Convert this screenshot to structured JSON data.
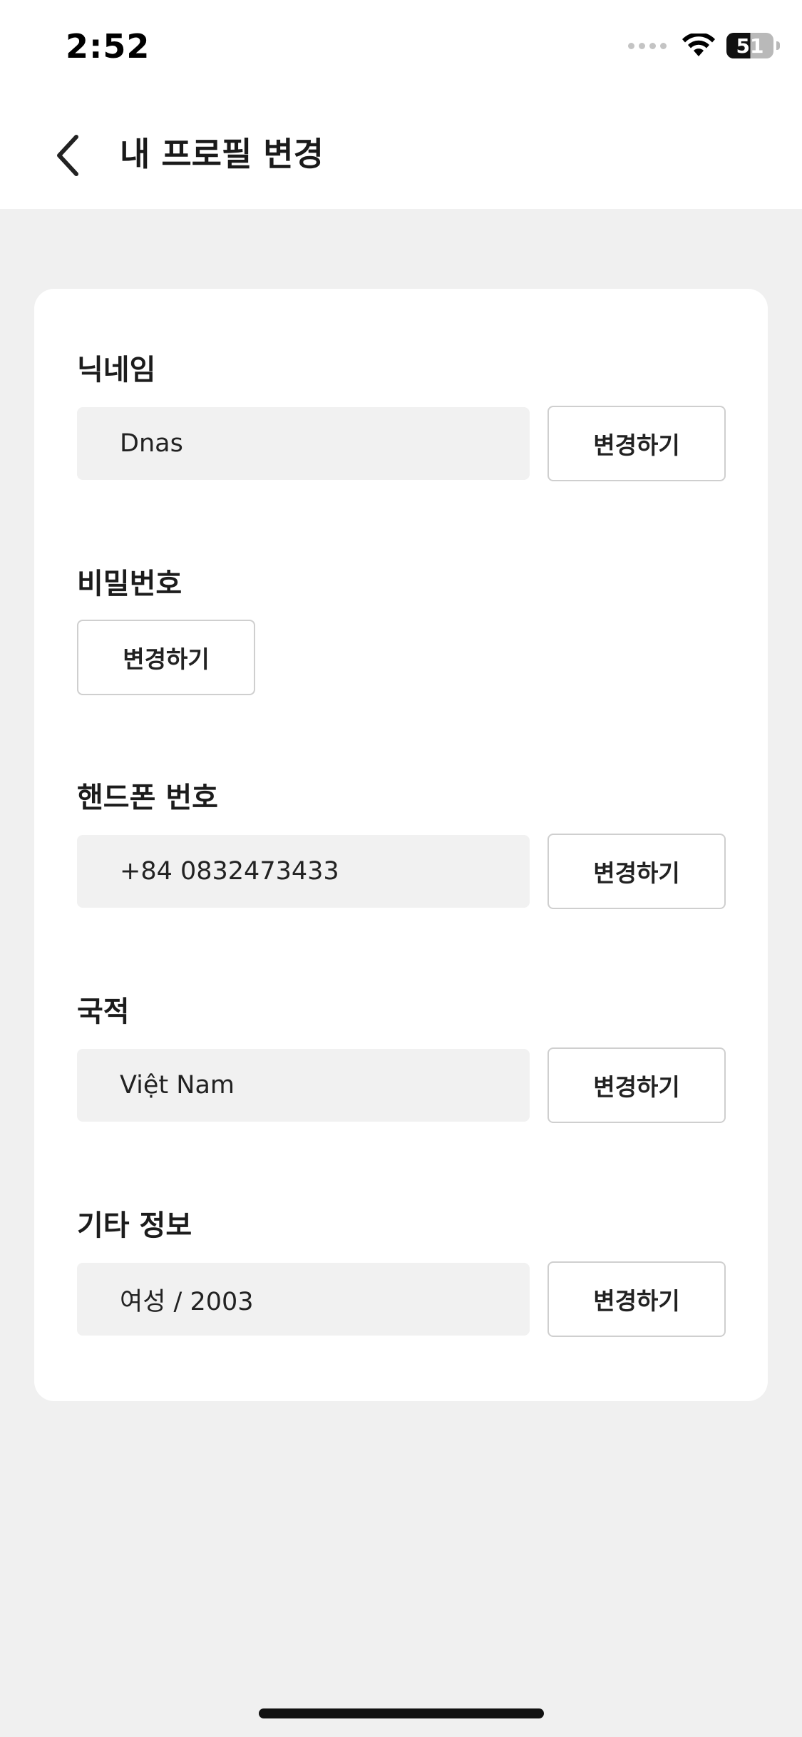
{
  "status_bar": {
    "time": "2:52",
    "battery_level": "51",
    "battery_fraction": 0.51
  },
  "header": {
    "back_icon": "chevron-left-icon",
    "title": "내 프로필 변경"
  },
  "profile": {
    "nickname": {
      "label": "닉네임",
      "value": "Dnas",
      "button": "변경하기"
    },
    "password": {
      "label": "비밀번호",
      "button": "변경하기"
    },
    "phone": {
      "label": "핸드폰 번호",
      "value": "+84 0832473433",
      "button": "변경하기"
    },
    "nationality": {
      "label": "국적",
      "value": "Việt Nam",
      "button": "변경하기"
    },
    "other_info": {
      "label": "기타 정보",
      "value": "여성 / 2003",
      "button": "변경하기"
    }
  },
  "colors": {
    "background": "#f0f0f0",
    "card": "#ffffff",
    "field": "#f1f1f1",
    "button_border": "#cfcfcf",
    "text": "#1c1c1c"
  }
}
